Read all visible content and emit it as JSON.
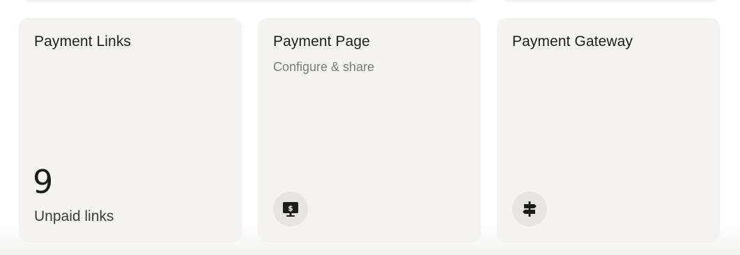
{
  "cards": [
    {
      "title": "Payment Links",
      "metric_value": "9",
      "metric_label": "Unpaid links"
    },
    {
      "title": "Payment Page",
      "subtitle": "Configure & share",
      "icon": "monitor-dollar-icon"
    },
    {
      "title": "Payment Gateway",
      "icon": "signpost-icon"
    }
  ],
  "colors": {
    "card_background": "#f4f3f0",
    "icon_circle": "#e6e5e1",
    "title_text": "#1d1d1b",
    "subtitle_text": "#7a7a76"
  }
}
